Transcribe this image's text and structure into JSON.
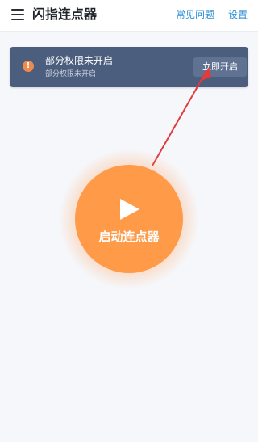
{
  "header": {
    "title": "闪指连点器",
    "faq_label": "常见问题",
    "settings_label": "设置"
  },
  "permission_banner": {
    "icon_glyph": "!",
    "title": "部分权限未开启",
    "subtitle": "部分权限未开启",
    "button_label": "立即开启"
  },
  "main": {
    "start_label": "启动连点器"
  },
  "colors": {
    "accent_orange": "#ff9a48",
    "banner_bg": "#4b5e7d",
    "link_blue": "#2f8fd6",
    "arrow_red": "#e23b3b"
  }
}
